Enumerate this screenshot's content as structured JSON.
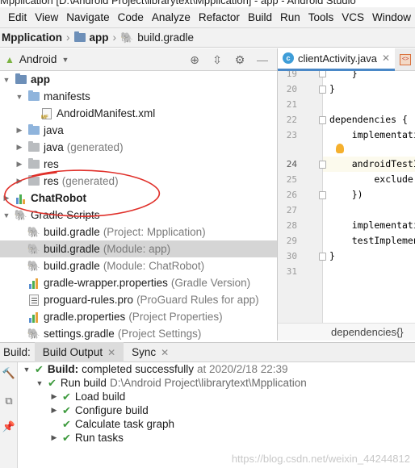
{
  "window": {
    "title": "Mpplication [D:\\Android Project\\librarytext\\Mpplication] - app - Android Studio"
  },
  "menu": [
    "Edit",
    "View",
    "Navigate",
    "Code",
    "Analyze",
    "Refactor",
    "Build",
    "Run",
    "Tools",
    "VCS",
    "Window"
  ],
  "nav": {
    "project": "Mpplication",
    "module": "app",
    "file": "build.gradle"
  },
  "project_panel": {
    "view_selector": "Android",
    "tree": [
      {
        "label": "app",
        "sub": "",
        "bold": true,
        "expanded": true
      },
      {
        "label": "manifests",
        "sub": ""
      },
      {
        "label": "AndroidManifest.xml",
        "sub": ""
      },
      {
        "label": "java",
        "sub": ""
      },
      {
        "label": "java",
        "sub": "(generated)"
      },
      {
        "label": "res",
        "sub": ""
      },
      {
        "label": "res",
        "sub": "(generated)"
      },
      {
        "label": "ChatRobot",
        "sub": "",
        "bold": true
      },
      {
        "label": "Gradle Scripts",
        "sub": ""
      },
      {
        "label": "build.gradle",
        "sub": "(Project: Mpplication)"
      },
      {
        "label": "build.gradle",
        "sub": "(Module: app)",
        "selected": true
      },
      {
        "label": "build.gradle",
        "sub": "(Module: ChatRobot)"
      },
      {
        "label": "gradle-wrapper.properties",
        "sub": "(Gradle Version)"
      },
      {
        "label": "proguard-rules.pro",
        "sub": "(ProGuard Rules for app)"
      },
      {
        "label": "gradle.properties",
        "sub": "(Project Properties)"
      },
      {
        "label": "settings.gradle",
        "sub": "(Project Settings)"
      }
    ]
  },
  "editor": {
    "tabs": [
      {
        "label": "clientActivity.java",
        "active": true
      }
    ],
    "lines": [
      {
        "n": "19",
        "code": "    }"
      },
      {
        "n": "20",
        "code": "}"
      },
      {
        "n": "21",
        "code": ""
      },
      {
        "n": "22",
        "code": "dependencies {"
      },
      {
        "n": "23",
        "code": "    implementation"
      },
      {
        "n": "24",
        "code": "    androidTestImp"
      },
      {
        "n": "25",
        "code": "        exclude gr"
      },
      {
        "n": "26",
        "code": "    })"
      },
      {
        "n": "27",
        "code": ""
      },
      {
        "n": "28",
        "code": "    implementation"
      },
      {
        "n": "29",
        "code": "    testImplementa"
      },
      {
        "n": "30",
        "code": "}"
      },
      {
        "n": "31",
        "code": ""
      }
    ],
    "breadcrumb": "dependencies{}"
  },
  "build_panel": {
    "label": "Build:",
    "tabs": [
      {
        "label": "Build Output",
        "active": true
      },
      {
        "label": "Sync",
        "active": false
      }
    ],
    "rows": [
      {
        "prefix": "Build:",
        "text": "completed successfully",
        "ts": "at 2020/2/18 22:39"
      },
      {
        "prefix": "Run build",
        "path": "D:\\Android Project\\librarytext\\Mpplication"
      },
      {
        "text": "Load build"
      },
      {
        "text": "Configure build"
      },
      {
        "text": "Calculate task graph"
      },
      {
        "text": "Run tasks"
      }
    ]
  },
  "watermark": "https://blog.csdn.net/weixin_44244812",
  "colors": {
    "accent": "#4a88c7",
    "success": "#3d9a3d",
    "annotation": "#e0302a"
  }
}
